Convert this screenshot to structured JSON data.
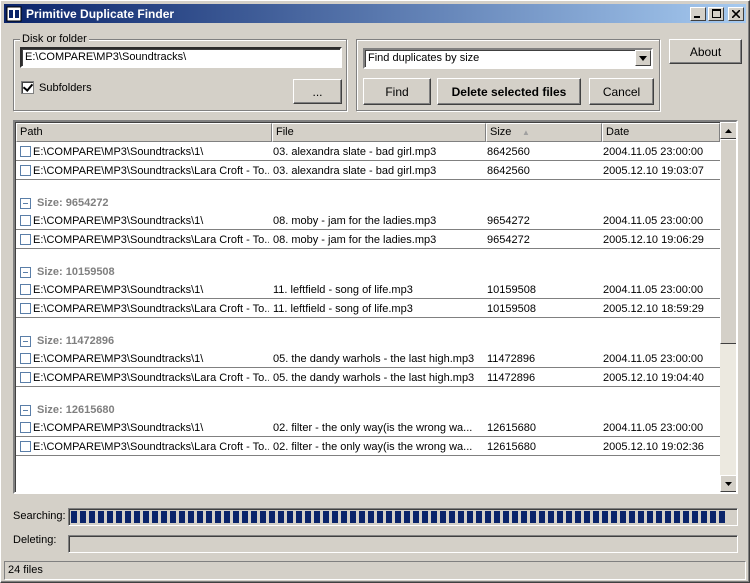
{
  "window": {
    "title": "Primitive Duplicate Finder"
  },
  "source": {
    "legend": "Disk or folder",
    "path": "E:\\COMPARE\\MP3\\Soundtracks\\",
    "subfolders_label": "Subfolders",
    "subfolders_checked": true,
    "browse_label": "..."
  },
  "controls": {
    "mode": "Find duplicates by size",
    "find_label": "Find",
    "delete_label": "Delete selected files",
    "cancel_label": "Cancel",
    "about_label": "About"
  },
  "table": {
    "columns": [
      "Path",
      "File",
      "Size",
      "Date"
    ],
    "sort_indicator": "▲",
    "top_rows": [
      {
        "path": "E:\\COMPARE\\MP3\\Soundtracks\\1\\",
        "file": "03. alexandra slate - bad girl.mp3",
        "size": "8642560",
        "date": "2004.11.05 23:00:00"
      },
      {
        "path": "E:\\COMPARE\\MP3\\Soundtracks\\Lara Croft - To...",
        "file": "03. alexandra slate - bad girl.mp3",
        "size": "8642560",
        "date": "2005.12.10 19:03:07"
      }
    ],
    "groups": [
      {
        "label": "Size: 9654272",
        "rows": [
          {
            "path": "E:\\COMPARE\\MP3\\Soundtracks\\1\\",
            "file": "08. moby - jam for the ladies.mp3",
            "size": "9654272",
            "date": "2004.11.05 23:00:00"
          },
          {
            "path": "E:\\COMPARE\\MP3\\Soundtracks\\Lara Croft - To...",
            "file": "08. moby - jam for the ladies.mp3",
            "size": "9654272",
            "date": "2005.12.10 19:06:29"
          }
        ]
      },
      {
        "label": "Size: 10159508",
        "rows": [
          {
            "path": "E:\\COMPARE\\MP3\\Soundtracks\\1\\",
            "file": "11. leftfield - song of life.mp3",
            "size": "10159508",
            "date": "2004.11.05 23:00:00"
          },
          {
            "path": "E:\\COMPARE\\MP3\\Soundtracks\\Lara Croft - To...",
            "file": "11. leftfield - song of life.mp3",
            "size": "10159508",
            "date": "2005.12.10 18:59:29"
          }
        ]
      },
      {
        "label": "Size: 11472896",
        "rows": [
          {
            "path": "E:\\COMPARE\\MP3\\Soundtracks\\1\\",
            "file": "05. the dandy warhols - the last high.mp3",
            "size": "11472896",
            "date": "2004.11.05 23:00:00"
          },
          {
            "path": "E:\\COMPARE\\MP3\\Soundtracks\\Lara Croft - To...",
            "file": "05. the dandy warhols - the last high.mp3",
            "size": "11472896",
            "date": "2005.12.10 19:04:40"
          }
        ]
      },
      {
        "label": "Size: 12615680",
        "rows": [
          {
            "path": "E:\\COMPARE\\MP3\\Soundtracks\\1\\",
            "file": "02. filter - the only way(is the wrong wa...",
            "size": "12615680",
            "date": "2004.11.05 23:00:00"
          },
          {
            "path": "E:\\COMPARE\\MP3\\Soundtracks\\Lara Croft - To...",
            "file": "02. filter - the only way(is the wrong wa...",
            "size": "12615680",
            "date": "2005.12.10 19:02:36"
          }
        ]
      }
    ]
  },
  "progress": {
    "searching_label": "Searching:",
    "searching_value": 1.0,
    "deleting_label": "Deleting:",
    "deleting_value": 0.0
  },
  "status": {
    "text": "24 files"
  },
  "colors": {
    "titlebar": "#0a246a",
    "progress_fill": "#0a246a",
    "group_text": "#808080"
  }
}
